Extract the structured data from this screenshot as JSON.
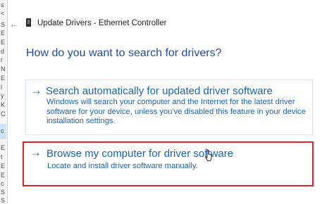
{
  "background_window": {
    "fragments": [
      "s",
      "<",
      "S",
      "E",
      "E",
      "d",
      "r",
      "N",
      "E",
      "l",
      "y",
      "K",
      "C",
      "c",
      "E",
      "t",
      "E",
      "E",
      "c",
      "S",
      "S",
      "E"
    ]
  },
  "title_bar": {
    "back_icon": "back-arrow-icon",
    "device_icon": "device-icon",
    "title": "Update Drivers - Ethernet Controller"
  },
  "main": {
    "heading": "How do you want to search for drivers?",
    "options": [
      {
        "arrow": "→",
        "title": "Search automatically for updated driver software",
        "description": "Windows will search your computer and the Internet for the latest driver software for your device, unless you've disabled this feature in your device installation settings."
      },
      {
        "arrow": "→",
        "title": "Browse my computer for driver software",
        "description": "Locate and install driver software manually."
      }
    ]
  },
  "colors": {
    "link_blue": "#1a63b0",
    "heading_blue": "#1f4b99",
    "highlight_red": "#e02424"
  }
}
